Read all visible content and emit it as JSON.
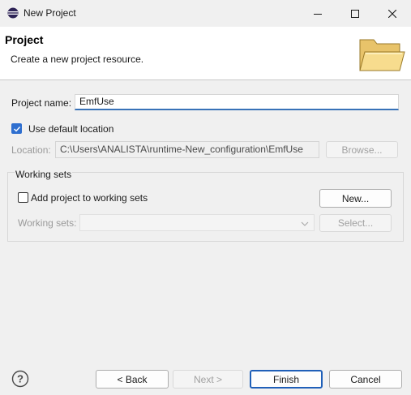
{
  "window": {
    "title": "New Project"
  },
  "header": {
    "title": "Project",
    "description": "Create a new project resource."
  },
  "form": {
    "project_name_label": "Project name:",
    "project_name_value": "EmfUse",
    "use_default_location_label": "Use default location",
    "use_default_location_checked": true,
    "location_label": "Location:",
    "location_value": "C:\\Users\\ANALISTA\\runtime-New_configuration\\EmfUse",
    "browse_label": "Browse..."
  },
  "working_sets": {
    "group_label": "Working sets",
    "add_label": "Add project to working sets",
    "add_checked": false,
    "new_label": "New...",
    "working_sets_label": "Working sets:",
    "working_sets_value": "",
    "select_label": "Select..."
  },
  "buttons": {
    "back": "< Back",
    "next": "Next >",
    "finish": "Finish",
    "cancel": "Cancel"
  },
  "icons": {
    "app": "eclipse-icon",
    "minimize": "minimize-icon",
    "maximize": "maximize-icon",
    "close": "close-icon",
    "banner": "folder-icon",
    "help": "help-icon",
    "dropdown": "chevron-down-icon"
  },
  "colors": {
    "accent": "#2f6fcf",
    "finish_border": "#1f5fb8",
    "input_underline": "#3872b8"
  }
}
